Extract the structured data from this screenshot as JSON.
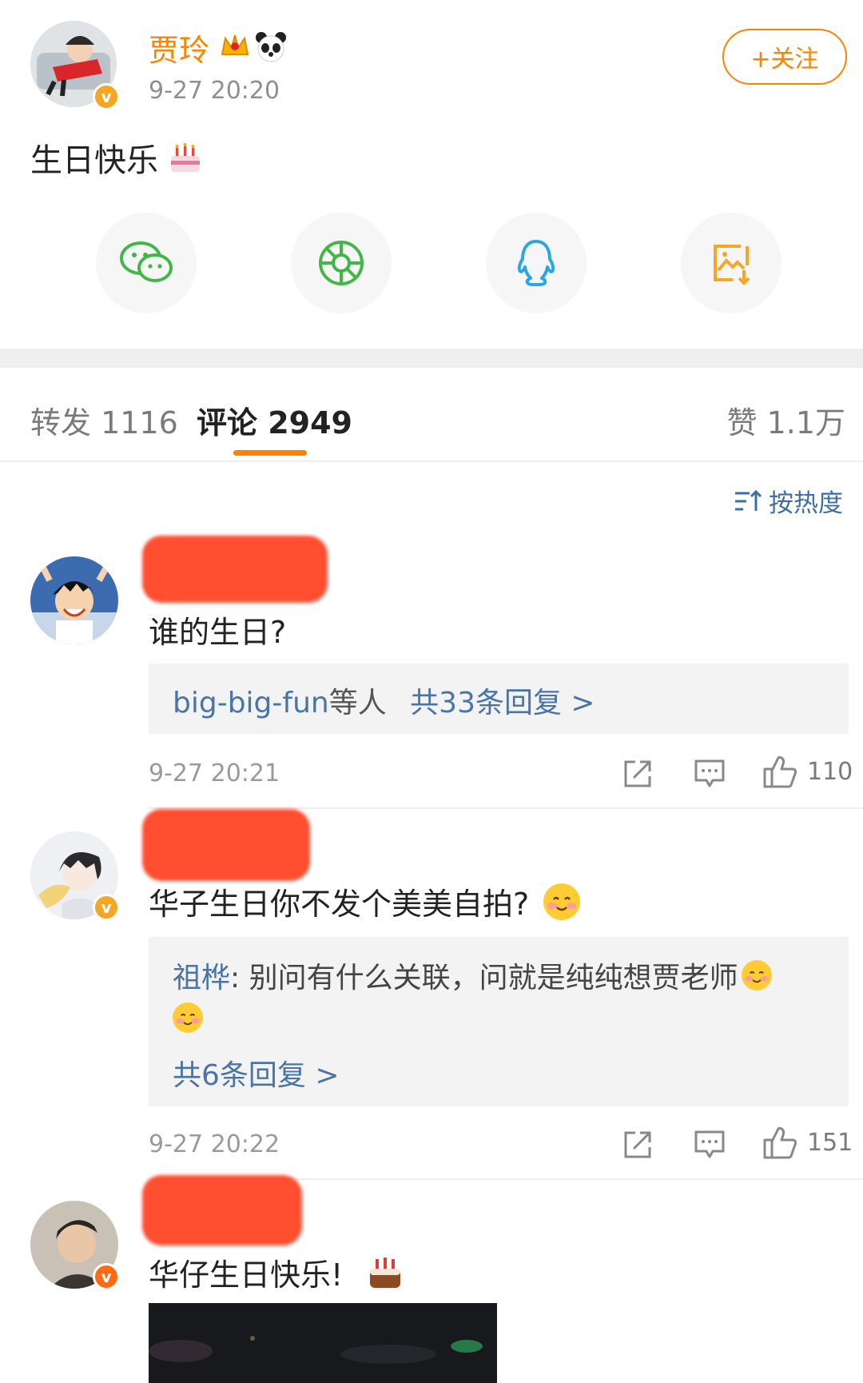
{
  "post": {
    "author": "贾玲",
    "time": "9-27 20:20",
    "follow_label": "+关注",
    "text": "生日快乐"
  },
  "share": {
    "icons": [
      "wechat-icon",
      "moments-icon",
      "qq-icon",
      "save-image-icon"
    ]
  },
  "tabs": {
    "repost": "转发 1116",
    "comments": "评论 2949",
    "likes": "赞 1.1万"
  },
  "sort_label": "按热度",
  "comments": [
    {
      "text": "谁的生日?",
      "reply_users": "big-big-fun",
      "reply_mid": "等人",
      "reply_total": "共33条回复 >",
      "time": "9-27 20:21",
      "likes": "110"
    },
    {
      "text": "华子生日你不发个美美自拍?",
      "reply_user": "祖桦",
      "reply_text": ": 别问有什么关联，问就是纯纯想贾老师",
      "reply_total": "共6条回复 >",
      "time": "9-27 20:22",
      "likes": "151"
    },
    {
      "text": "华仔生日快乐!"
    }
  ],
  "colors": {
    "accent": "#ff8200",
    "link": "#4a74a6",
    "badge": "#f5a623"
  }
}
